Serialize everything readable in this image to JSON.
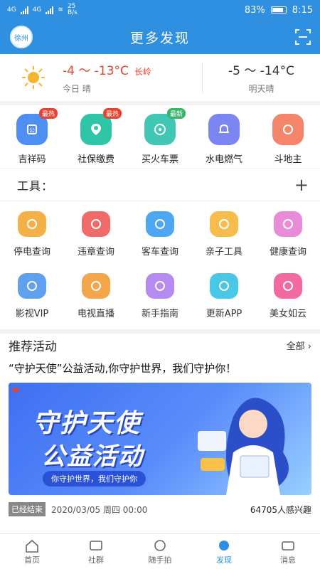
{
  "status": {
    "time": "8:15",
    "battery": "83%",
    "net_speed": "25",
    "net_unit": "B/s",
    "sig1": "4G",
    "sig2": "4G"
  },
  "app": {
    "title": "更多发现",
    "avatar_text": "徐州"
  },
  "weather": {
    "today_temp": "-4 ～ -13°C",
    "city": "长岭",
    "today_label": "今日 晴",
    "tomorrow_temp": "-5 ～ -14°C",
    "tomorrow_label": "明天晴"
  },
  "quick": [
    {
      "label": "吉祥码",
      "badge": "最热",
      "color": "#4f8ff3"
    },
    {
      "label": "社保缴费",
      "badge": "最热",
      "color": "#2fc6a8"
    },
    {
      "label": "买火车票",
      "badge": "最新",
      "color": "#41c8b4"
    },
    {
      "label": "水电燃气",
      "badge": "",
      "color": "#7b86f2"
    },
    {
      "label": "斗地主",
      "badge": "",
      "color": "#f4856a"
    }
  ],
  "tools": {
    "title": "工具：",
    "items": [
      {
        "label": "停电查询",
        "color": "#f5b04a"
      },
      {
        "label": "违章查询",
        "color": "#f06a6a"
      },
      {
        "label": "客车查询",
        "color": "#4ea7f2"
      },
      {
        "label": "亲子工具",
        "color": "#f6bd4c"
      },
      {
        "label": "健康查询",
        "color": "#e88bd8"
      },
      {
        "label": "影视VIP",
        "color": "#5fa0f0"
      },
      {
        "label": "电视直播",
        "color": "#f6a64a"
      },
      {
        "label": "新手指南",
        "color": "#b58bf2"
      },
      {
        "label": "更新APP",
        "color": "#49c7e6"
      },
      {
        "label": "美女如云",
        "color": "#f36aa0"
      }
    ]
  },
  "recommend": {
    "title": "推荐活动",
    "all": "全部 ›",
    "item_title": "“守护天使”公益活动,你守护世界，我们守护你！",
    "banner_line1": "守护天使",
    "banner_line2": "公益活动",
    "banner_pill": "你守护世界，我们守护你",
    "status": "已经结束",
    "date": "2020/03/05 周四 00:00",
    "count": "64705人感兴趣"
  },
  "tabs": [
    {
      "label": "首页"
    },
    {
      "label": "社群"
    },
    {
      "label": "随手拍"
    },
    {
      "label": "发现"
    },
    {
      "label": "消息"
    }
  ]
}
